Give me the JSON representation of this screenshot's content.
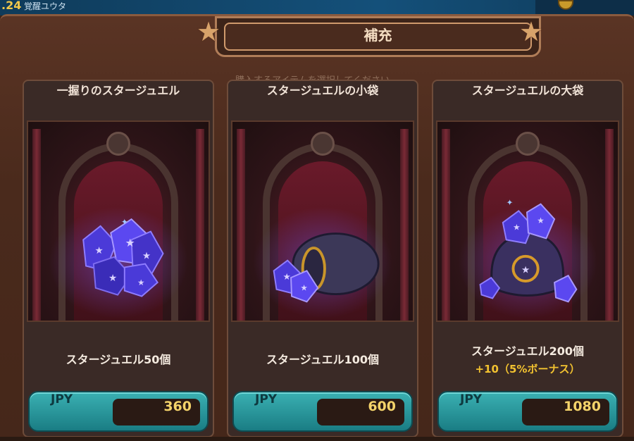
{
  "top": {
    "level": ".24",
    "name": "覚醒ユウタ"
  },
  "dialog": {
    "title": "補充",
    "subtitle": "購入するアイテムを選択してください。"
  },
  "products": [
    {
      "name": "一握りのスタージュエル",
      "description": "スタージュエル50個",
      "bonus": "",
      "currency": "JPY",
      "price": "360",
      "art": "gem-cluster-icon"
    },
    {
      "name": "スタージュエルの小袋",
      "description": "スタージュエル100個",
      "bonus": "",
      "currency": "JPY",
      "price": "600",
      "art": "small-gem-bag-icon"
    },
    {
      "name": "スタージュエルの大袋",
      "description": "スタージュエル200個",
      "bonus": "+10（5%ボーナス）",
      "currency": "JPY",
      "price": "1080",
      "art": "large-gem-bag-icon"
    }
  ],
  "colors": {
    "panel": "#4a2a1c",
    "button": "#2a9ca0",
    "price_text": "#f4d36a",
    "bonus_text": "#f2c230",
    "gem": "#5a4aff"
  }
}
